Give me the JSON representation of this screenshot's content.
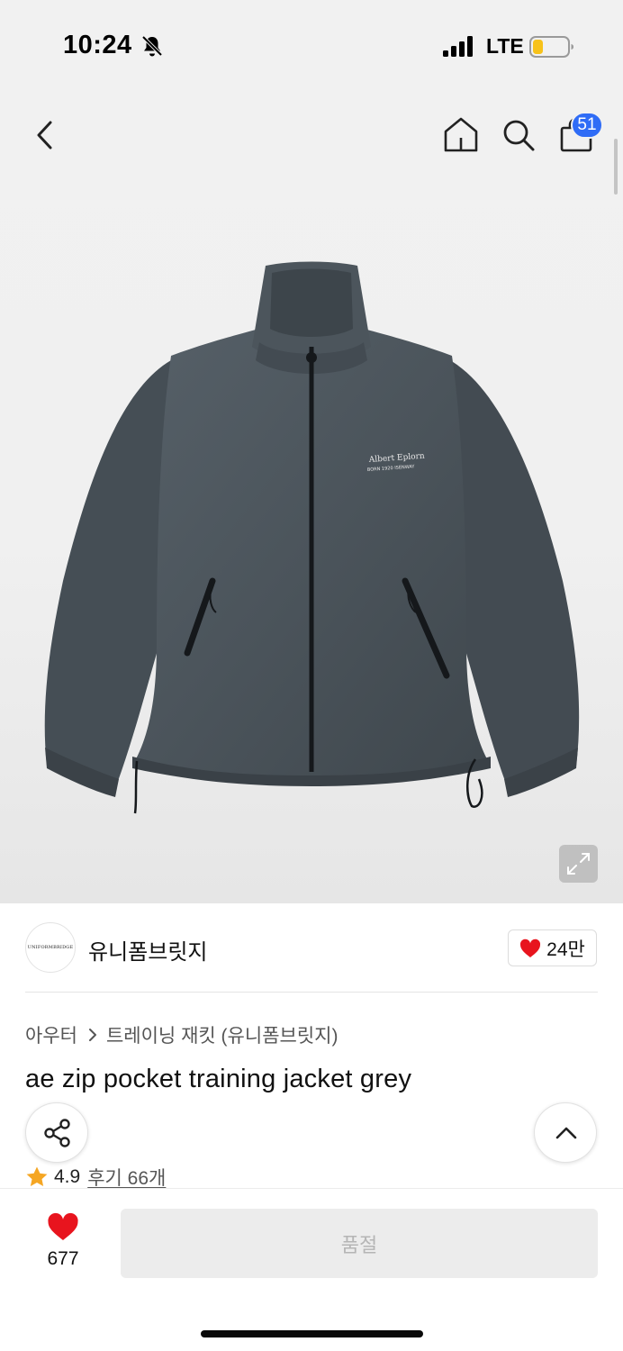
{
  "status_bar": {
    "time": "10:24",
    "network": "LTE",
    "icons": [
      "bell-slash-icon",
      "signal-icon",
      "battery-icon"
    ]
  },
  "header": {
    "icons": [
      "back-icon",
      "home-icon",
      "search-icon",
      "cart-icon"
    ],
    "cart_badge": "51"
  },
  "hero": {
    "image": "jacket-photo",
    "print_line1": "Albert Eplorn",
    "print_line2": "BORN 1920 ISENWAY"
  },
  "brand": {
    "logo_text": "UNIFORMBRIDGE",
    "name": "유니폼브릿지",
    "like_count": "24만"
  },
  "product": {
    "breadcrumb": [
      "아우터",
      "트레이닝 재킷 (유니폼브릿지)"
    ],
    "title": "ae zip pocket training jacket grey",
    "rating": "4.9",
    "reviews": "후기 66개"
  },
  "bottom_bar": {
    "wish_count": "677",
    "action_label": "품절"
  },
  "colors": {
    "accent_blue": "#2f6cf6",
    "heart_red": "#e8141e",
    "star_orange": "#f5a623",
    "jacket_grey": "#4a535a"
  }
}
